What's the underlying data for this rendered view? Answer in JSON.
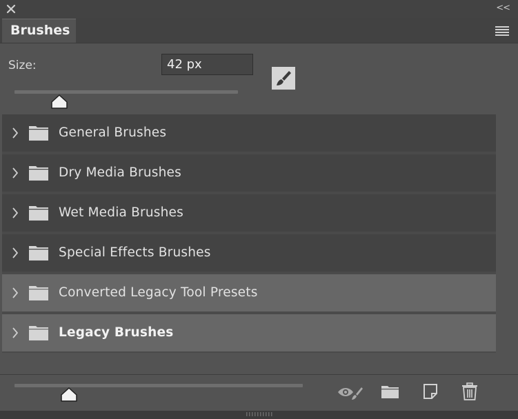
{
  "panel": {
    "tab_title": "Brushes",
    "collapse_glyph": "<<"
  },
  "size": {
    "label": "Size:",
    "value": "42 px",
    "slider_fraction": 0.2
  },
  "brush_groups": [
    {
      "label": "General Brushes",
      "highlighted": false
    },
    {
      "label": "Dry Media Brushes",
      "highlighted": false
    },
    {
      "label": "Wet Media Brushes",
      "highlighted": false
    },
    {
      "label": "Special Effects Brushes",
      "highlighted": false
    },
    {
      "label": "Converted Legacy Tool Presets",
      "highlighted": true
    },
    {
      "label": "Legacy Brushes",
      "highlighted": true,
      "bold": true
    }
  ],
  "footer": {
    "thumbnail_slider_fraction": 0.19,
    "icons": [
      "eye-brush-icon",
      "new-folder-icon",
      "new-brush-icon",
      "trash-icon"
    ]
  },
  "colors": {
    "panel_bg": "#535353",
    "list_item_bg": "#434343",
    "list_item_highlight": "#676767",
    "text": "#e6e6e6"
  }
}
